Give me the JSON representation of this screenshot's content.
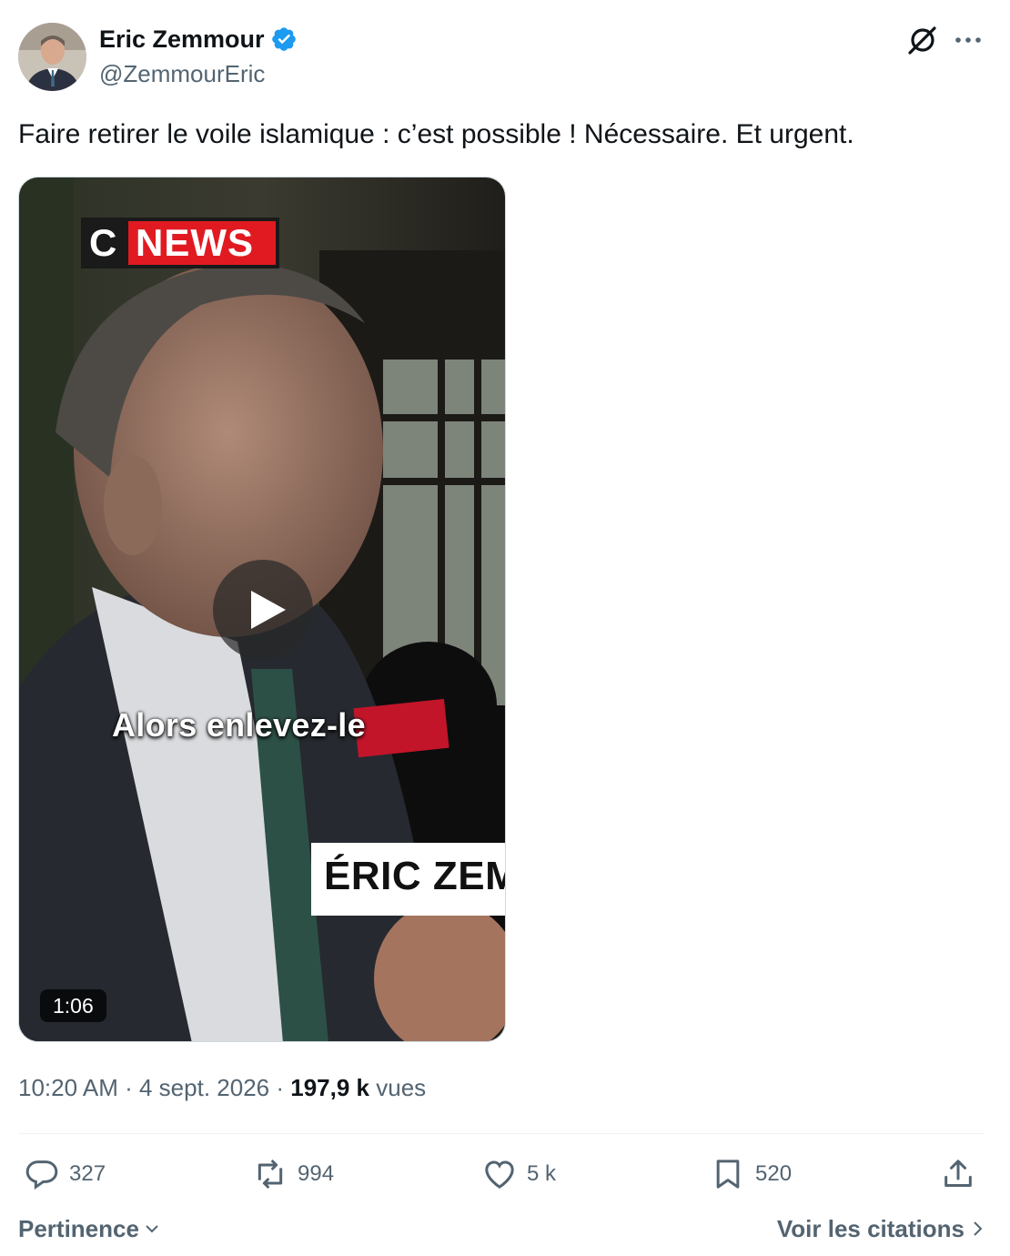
{
  "author": {
    "name": "Eric Zemmour",
    "handle": "@ZemmourEric",
    "verified": true,
    "verified_color": "#1d9bf0"
  },
  "header_icons": [
    "grok-icon",
    "more-options-icon"
  ],
  "tweet": {
    "text": "Faire retirer le voile islamique : c’est possible ! Nécessaire. Et urgent."
  },
  "video": {
    "channel_logo_letter": "C",
    "channel_logo_word": "NEWS",
    "subtitle": "Alors enlevez-le",
    "name_caption": "ÉRIC ZEM",
    "duration": "1:06",
    "mic_flag_text": "",
    "play_icon": "play-icon"
  },
  "meta": {
    "time": "10:20 AM",
    "date": "4 sept. 2026",
    "views_count": "197,9 k",
    "views_label": "vues",
    "separator": "·"
  },
  "actions": {
    "replies": "327",
    "reposts": "994",
    "likes": "5 k",
    "bookmarks": "520"
  },
  "footer": {
    "sort_label": "Pertinence",
    "quotes_label": "Voir les citations"
  }
}
